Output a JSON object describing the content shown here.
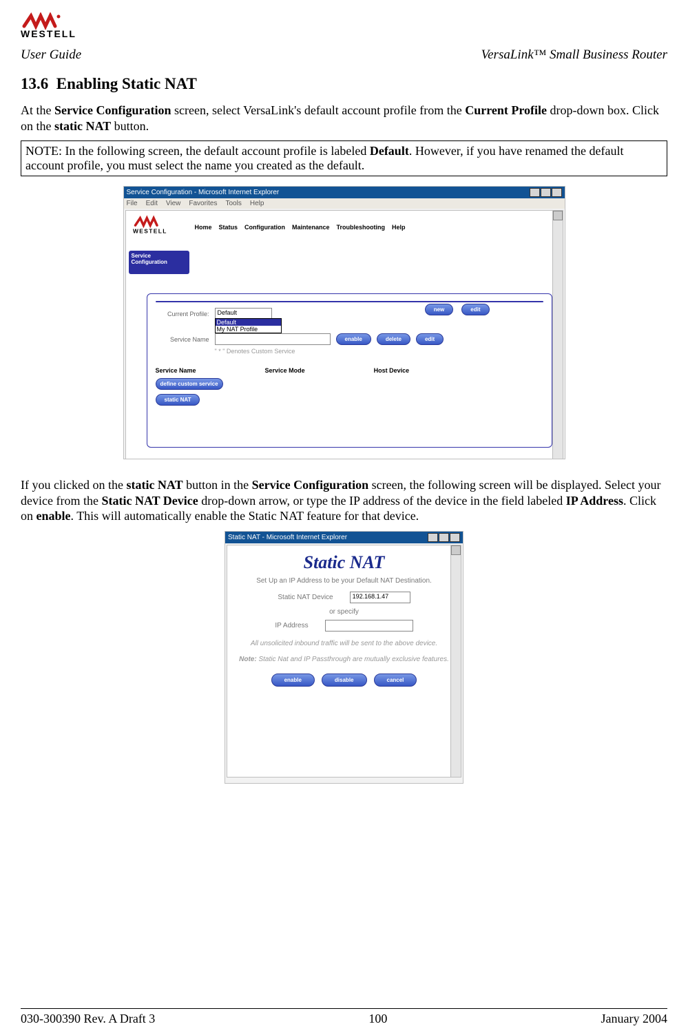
{
  "header": {
    "left": "User Guide",
    "right": "VersaLink™  Small Business Router",
    "brand": "WESTELL"
  },
  "section": {
    "number": "13.6",
    "title": "Enabling Static NAT"
  },
  "para1": {
    "pre": "At the ",
    "b1": "Service Configuration",
    "mid1": " screen, select VersaLink's default account profile from the ",
    "b2": "Current Profile",
    "mid2": " drop-down box. Click on the ",
    "b3": "static NAT",
    "post": " button."
  },
  "note": {
    "pre": "NOTE: In the following screen, the default account profile is labeled ",
    "b1": "Default",
    "post": ". However, if you have renamed the default account profile, you must select the name you created as the default."
  },
  "shot1": {
    "title": "Service Configuration - Microsoft Internet Explorer",
    "menus": [
      "File",
      "Edit",
      "View",
      "Favorites",
      "Tools",
      "Help"
    ],
    "nav": [
      "Home",
      "Status",
      "Configuration",
      "Maintenance",
      "Troubleshooting",
      "Help"
    ],
    "tab": "Service Configuration",
    "row1_label": "Current Profile:",
    "row1_value": "Default",
    "dd_opt1": "Default",
    "dd_opt2": "My NAT Profile",
    "row2_label": "Service Name",
    "row2_note": "\" * \" Denotes Custom Service",
    "btns_top": {
      "new": "new",
      "edit": "edit"
    },
    "btns_mid": {
      "enable": "enable",
      "delete": "delete",
      "edit": "edit"
    },
    "cols": {
      "c1": "Service Name",
      "c2": "Service Mode",
      "c3": "Host Device"
    },
    "btns_bot": {
      "def": "define custom service",
      "snat": "static NAT"
    }
  },
  "para2": {
    "pre": "If you clicked on the ",
    "b1": "static NAT",
    "mid1": " button in the ",
    "b2": "Service Configuration",
    "mid2": " screen, the following screen will be displayed. Select your device from the ",
    "b3": "Static NAT Device",
    "mid3": " drop-down arrow, or type the IP address of the device in the field labeled ",
    "b4": "IP Address",
    "mid4": ". Click on ",
    "b5": "enable",
    "post": ". This will automatically enable the Static NAT feature for that device."
  },
  "shot2": {
    "title": "Static NAT - Microsoft Internet Explorer",
    "hdr": "Static NAT",
    "sub": "Set Up an IP Address to be your Default NAT Destination.",
    "dev_label": "Static NAT Device",
    "dev_value": "192.168.1.47",
    "or": "or specify",
    "ip_label": "IP Address",
    "note1": "All unsolicited inbound traffic will be sent to the above device.",
    "note2_b": "Note:",
    "note2": " Static Nat and IP Passthrough are mutually exclusive features.",
    "btns": {
      "enable": "enable",
      "disable": "disable",
      "cancel": "cancel"
    }
  },
  "footer": {
    "left": "030-300390 Rev. A Draft 3",
    "center": "100",
    "right": "January 2004"
  }
}
